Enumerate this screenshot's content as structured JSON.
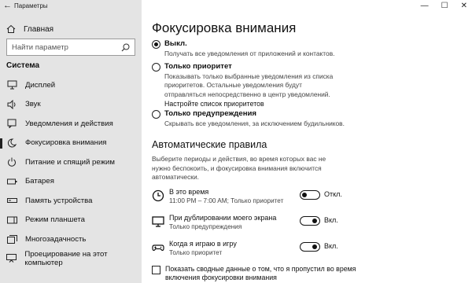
{
  "window": {
    "title": "Параметры",
    "controls": [
      "—",
      "☐",
      "✕"
    ]
  },
  "sidebar": {
    "home_label": "Главная",
    "search_placeholder": "Найти параметр",
    "section_title": "Система",
    "items": [
      {
        "label": "Дисплей",
        "icon": "display-icon"
      },
      {
        "label": "Звук",
        "icon": "sound-icon"
      },
      {
        "label": "Уведомления и действия",
        "icon": "notifications-icon"
      },
      {
        "label": "Фокусировка внимания",
        "icon": "focus-assist-icon",
        "active": true
      },
      {
        "label": "Питание и спящий режим",
        "icon": "power-icon"
      },
      {
        "label": "Батарея",
        "icon": "battery-icon"
      },
      {
        "label": "Память устройства",
        "icon": "storage-icon"
      },
      {
        "label": "Режим планшета",
        "icon": "tablet-icon"
      },
      {
        "label": "Многозадачность",
        "icon": "multitasking-icon"
      },
      {
        "label": "Проецирование на этот компьютер",
        "icon": "projecting-icon"
      }
    ]
  },
  "main": {
    "title": "Фокусировка внимания",
    "options": [
      {
        "label": "Выкл.",
        "desc": "Получать все уведомления от приложений и контактов.",
        "selected": true
      },
      {
        "label": "Только приоритет",
        "desc": "Показывать только выбранные уведомления из списка приоритетов. Остальные уведомления будут отправляться непосредственно в центр уведомлений.",
        "link": "Настройте список приоритетов",
        "selected": false
      },
      {
        "label": "Только предупреждения",
        "desc": "Скрывать все уведомления, за исключением будильников.",
        "selected": false
      }
    ],
    "rules_title": "Автоматические правила",
    "rules_desc": "Выберите периоды и действия, во время которых вас не нужно беспокоить, и фокусировка внимания включится автоматически.",
    "rules": [
      {
        "name": "В это время",
        "sub": "11:00 PM – 7:00 AM; Только приоритет",
        "state": "Откл.",
        "on": false,
        "icon": "clock-icon"
      },
      {
        "name": "При дублировании моего экрана",
        "sub": "Только предупреждения",
        "state": "Вкл.",
        "on": true,
        "icon": "monitor-icon"
      },
      {
        "name": "Когда я играю в игру",
        "sub": "Только приоритет",
        "state": "Вкл.",
        "on": true,
        "icon": "gamepad-icon"
      }
    ],
    "summary_checkbox": "Показать сводные данные о том, что я пропустил во время включения фокусировки внимания"
  }
}
